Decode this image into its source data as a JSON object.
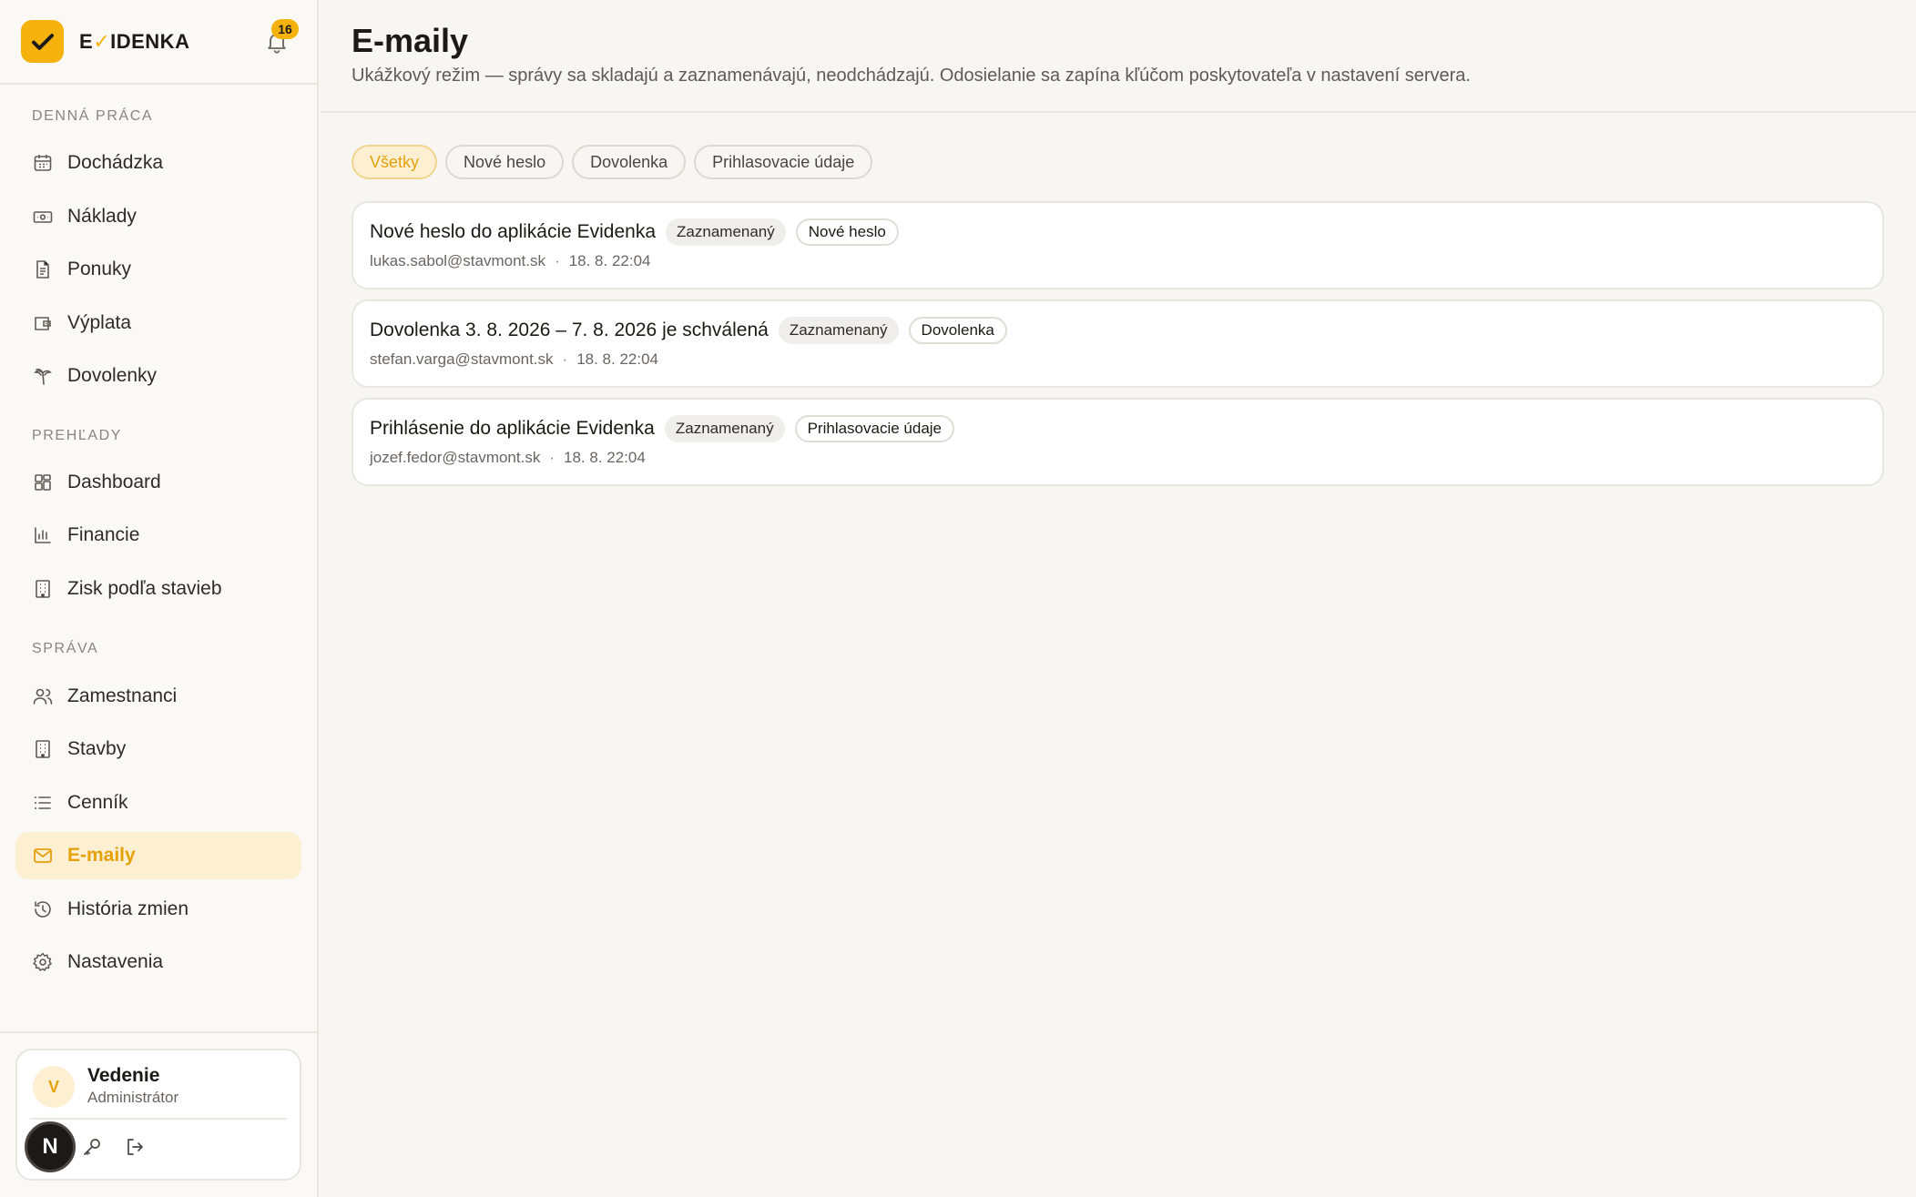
{
  "app": {
    "brand_prefix": "E",
    "brand_accent": "✓",
    "brand_suffix": "IDENKA",
    "notification_count": "16",
    "accent_color": "#f5b20d"
  },
  "sidebar": {
    "sections": [
      {
        "title": "Denná práca"
      },
      {
        "title": "Prehľady"
      },
      {
        "title": "Správa"
      }
    ],
    "items": [
      {
        "label": "Dochádzka",
        "icon": "calendar-icon"
      },
      {
        "label": "Náklady",
        "icon": "banknote-icon"
      },
      {
        "label": "Ponuky",
        "icon": "document-icon"
      },
      {
        "label": "Výplata",
        "icon": "wallet-icon"
      },
      {
        "label": "Dovolenky",
        "icon": "palm-tree-icon"
      },
      {
        "label": "Dashboard",
        "icon": "dashboard-grid-icon"
      },
      {
        "label": "Financie",
        "icon": "bar-chart-icon"
      },
      {
        "label": "Zisk podľa stavieb",
        "icon": "building-icon"
      },
      {
        "label": "Zamestnanci",
        "icon": "users-icon"
      },
      {
        "label": "Stavby",
        "icon": "building-icon"
      },
      {
        "label": "Cenník",
        "icon": "list-icon"
      },
      {
        "label": "E-maily",
        "icon": "mail-icon",
        "active": true
      },
      {
        "label": "História zmien",
        "icon": "history-icon"
      },
      {
        "label": "Nastavenia",
        "icon": "gear-icon"
      }
    ],
    "user": {
      "initial": "V",
      "name": "Vedenie",
      "role": "Administrátor",
      "badge": "N"
    }
  },
  "main": {
    "title": "E-maily",
    "subtitle": "Ukážkový režim — správy sa skladajú a zaznamenávajú, neodchádzajú. Odosielanie sa zapína kľúčom poskytovateľa v nastavení servera.",
    "filters": [
      {
        "label": "Všetky",
        "active": true
      },
      {
        "label": "Nové heslo"
      },
      {
        "label": "Dovolenka"
      },
      {
        "label": "Prihlasovacie údaje"
      }
    ],
    "emails": [
      {
        "subject": "Nové heslo do aplikácie Evidenka",
        "status": "Zaznamenaný",
        "type": "Nové heslo",
        "recipient": "lukas.sabol@stavmont.sk",
        "date": "18. 8. 22:04"
      },
      {
        "subject": "Dovolenka 3. 8. 2026 – 7. 8. 2026 je schválená",
        "status": "Zaznamenaný",
        "type": "Dovolenka",
        "recipient": "stefan.varga@stavmont.sk",
        "date": "18. 8. 22:04"
      },
      {
        "subject": "Prihlásenie do aplikácie Evidenka",
        "status": "Zaznamenaný",
        "type": "Prihlasovacie údaje",
        "recipient": "jozef.fedor@stavmont.sk",
        "date": "18. 8. 22:04"
      }
    ]
  }
}
